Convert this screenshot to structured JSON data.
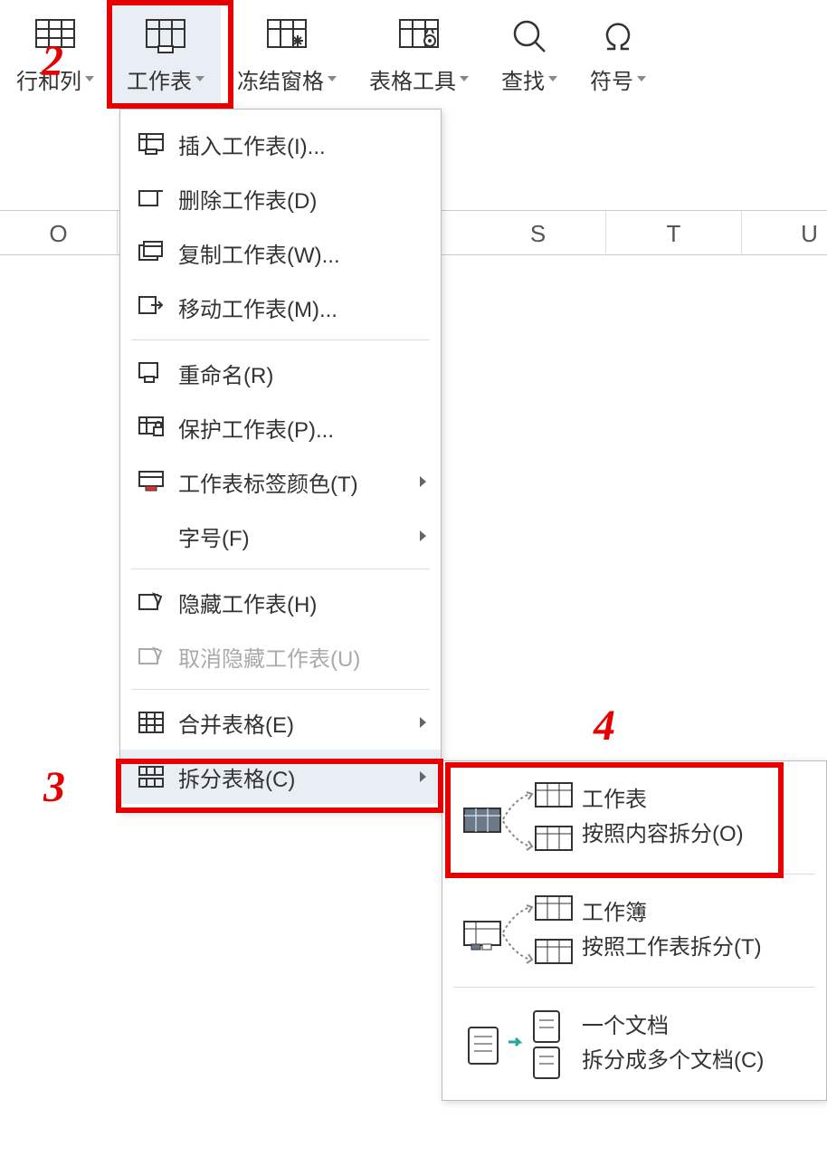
{
  "ribbon": {
    "rowcol": "行和列",
    "worksheet": "工作表",
    "freeze": "冻结窗格",
    "tabletools": "表格工具",
    "find": "查找",
    "symbol": "符号"
  },
  "columns": [
    "O",
    "",
    "S",
    "T",
    "U"
  ],
  "menu": {
    "insert": "插入工作表(I)...",
    "delete": "删除工作表(D)",
    "copy": "复制工作表(W)...",
    "move": "移动工作表(M)...",
    "rename": "重命名(R)",
    "protect": "保护工作表(P)...",
    "tabcolor": "工作表标签颜色(T)",
    "fontsize": "字号(F)",
    "hide": "隐藏工作表(H)",
    "unhide": "取消隐藏工作表(U)",
    "merge": "合并表格(E)",
    "split": "拆分表格(C)"
  },
  "submenu": {
    "s1a": "工作表",
    "s1b": "按照内容拆分(O)",
    "s2a": "工作簿",
    "s2b": "按照工作表拆分(T)",
    "s3a": "一个文档",
    "s3b": "拆分成多个文档(C)"
  },
  "badges": {
    "b2": "2",
    "b3": "3",
    "b4": "4"
  }
}
